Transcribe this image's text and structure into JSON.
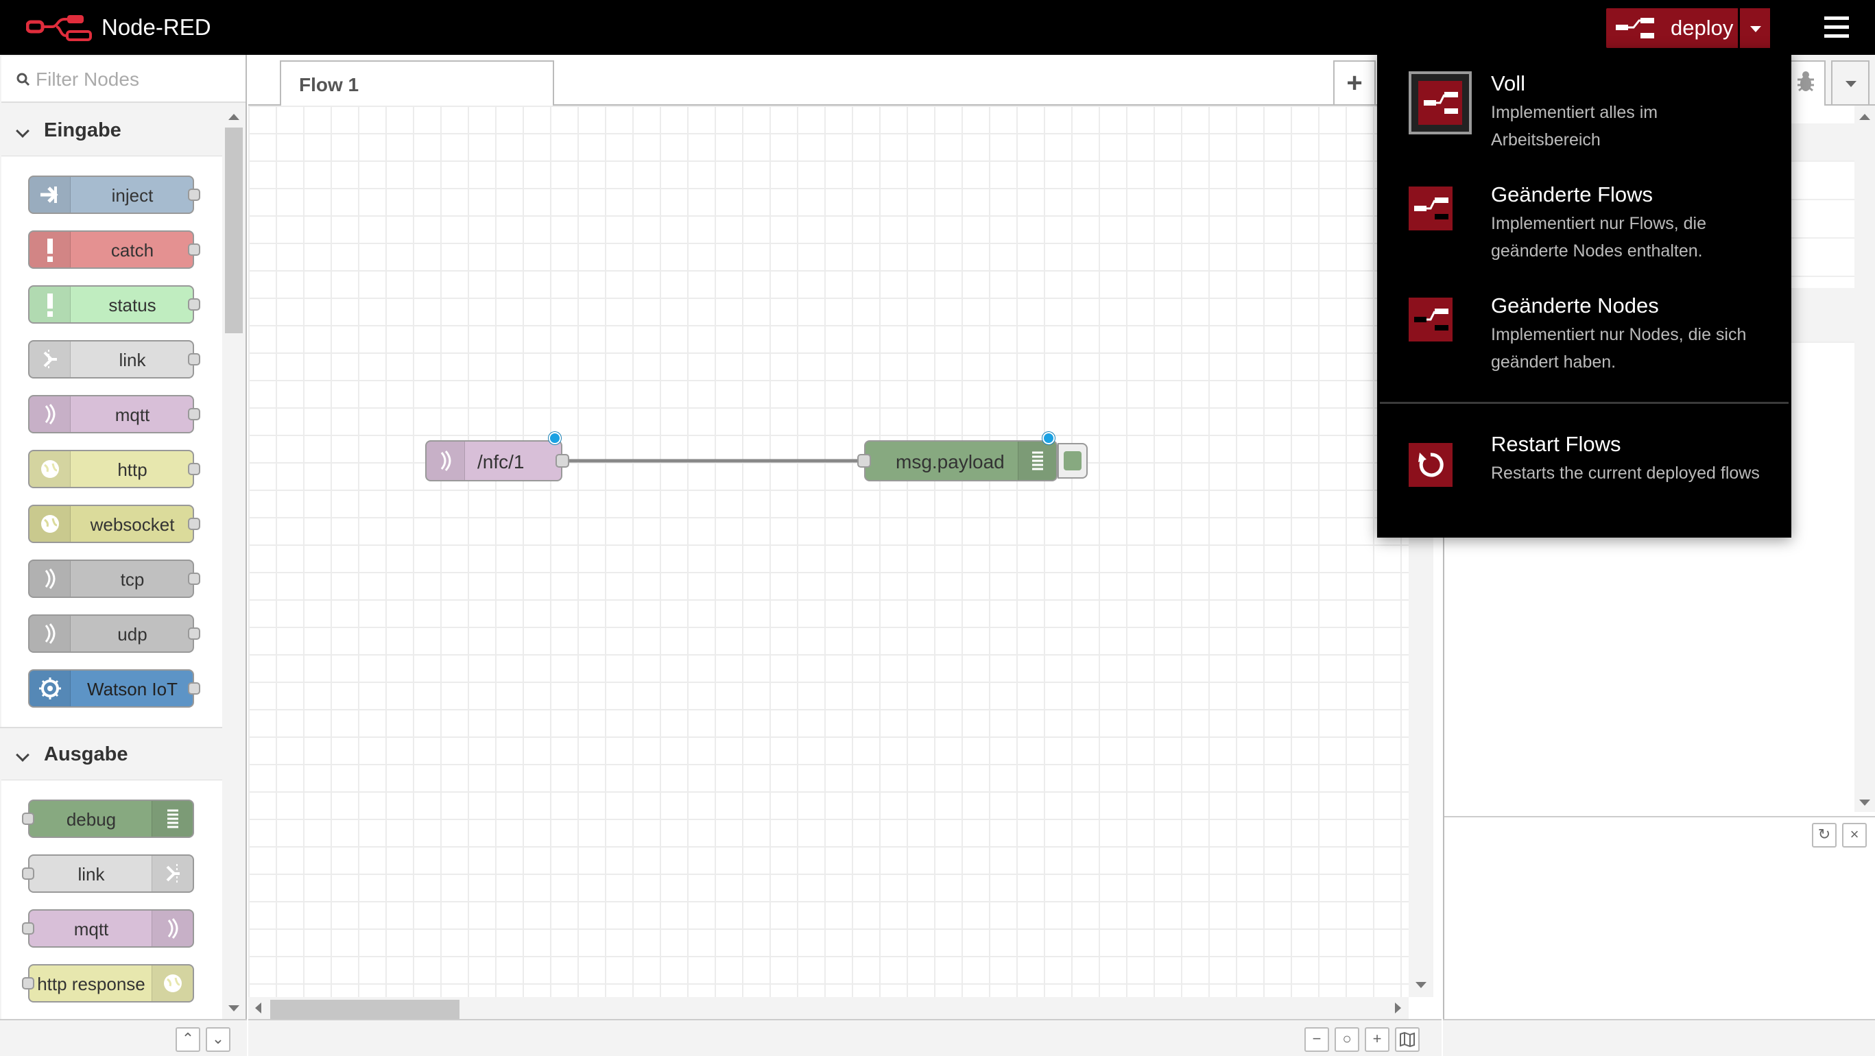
{
  "header": {
    "title": "Node-RED",
    "deploy_label": "deploy"
  },
  "palette": {
    "filter_placeholder": "Filter Nodes",
    "categories": [
      {
        "label": "Eingabe",
        "nodes": [
          {
            "label": "inject",
            "color": "#a6bbcf",
            "icon": "arrow-in-icon"
          },
          {
            "label": "catch",
            "color": "#e49191",
            "icon": "exclamation-icon"
          },
          {
            "label": "status",
            "color": "#c0edc0",
            "icon": "exclamation-icon"
          },
          {
            "label": "link",
            "color": "#dddddd",
            "icon": "link-icon"
          },
          {
            "label": "mqtt",
            "color": "#d8bfd8",
            "icon": "bridge-icon"
          },
          {
            "label": "http",
            "color": "#e7e7ae",
            "icon": "globe-icon"
          },
          {
            "label": "websocket",
            "color": "#dbdb9b",
            "icon": "globe-icon"
          },
          {
            "label": "tcp",
            "color": "#c0c0c0",
            "icon": "bridge-icon"
          },
          {
            "label": "udp",
            "color": "#c0c0c0",
            "icon": "bridge-icon"
          },
          {
            "label": "Watson IoT",
            "color": "#5d94c6",
            "icon": "chip-icon"
          }
        ]
      },
      {
        "label": "Ausgabe",
        "nodes": [
          {
            "label": "debug",
            "color": "#87a980",
            "icon": "list-icon"
          },
          {
            "label": "link",
            "color": "#dddddd",
            "icon": "link-icon"
          },
          {
            "label": "mqtt",
            "color": "#d8bfd8",
            "icon": "bridge-icon"
          },
          {
            "label": "http response",
            "color": "#e7e7ae",
            "icon": "globe-icon"
          }
        ]
      }
    ]
  },
  "workspace": {
    "tabs": [
      {
        "label": "Flow 1"
      }
    ],
    "add_tab": "+",
    "flow_nodes": [
      {
        "label": "/nfc/1",
        "color": "#d8bfd8"
      },
      {
        "label": "msg.payload",
        "color": "#87a980"
      }
    ]
  },
  "deploy_menu": {
    "items": [
      {
        "title": "Voll",
        "description": "Implementiert alles im Arbeitsbereich"
      },
      {
        "title": "Geänderte Flows",
        "description": "Implementiert nur Flows, die geänderte Nodes enthalten."
      },
      {
        "title": "Geänderte Nodes",
        "description": "Implementiert nur Nodes, die sich geändert haben."
      },
      {
        "title": "Restart Flows",
        "description": "Restarts the current deployed flows"
      }
    ]
  },
  "colors": {
    "header_bg": "#000000",
    "deploy_red": "#8c101c",
    "selected_port": "#1ba1e2"
  }
}
